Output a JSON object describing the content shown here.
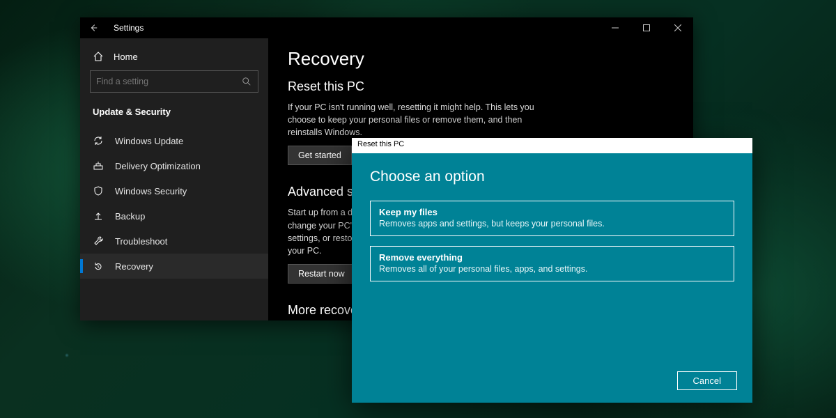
{
  "window": {
    "title": "Settings",
    "back_icon": "back-arrow-icon"
  },
  "sidebar": {
    "home_label": "Home",
    "search_placeholder": "Find a setting",
    "section_label": "Update & Security",
    "items": [
      {
        "icon": "sync-icon",
        "label": "Windows Update"
      },
      {
        "icon": "delivery-icon",
        "label": "Delivery Optimization"
      },
      {
        "icon": "shield-icon",
        "label": "Windows Security"
      },
      {
        "icon": "backup-icon",
        "label": "Backup"
      },
      {
        "icon": "wrench-icon",
        "label": "Troubleshoot"
      },
      {
        "icon": "recovery-icon",
        "label": "Recovery"
      }
    ]
  },
  "content": {
    "page_title": "Recovery",
    "reset": {
      "heading": "Reset this PC",
      "body": "If your PC isn't running well, resetting it might help. This lets you choose to keep your personal files or remove them, and then reinstalls Windows.",
      "button": "Get started"
    },
    "advanced": {
      "heading": "Advanced startup",
      "body": "Start up from a device or disc (such as a USB drive or DVD), change your PC's firmware settings, change Windows startup settings, or restore Windows from a system image. This will restart your PC.",
      "button": "Restart now"
    },
    "more_heading": "More recovery options"
  },
  "dialog": {
    "titlebar": "Reset this PC",
    "heading": "Choose an option",
    "options": [
      {
        "title": "Keep my files",
        "desc": "Removes apps and settings, but keeps your personal files."
      },
      {
        "title": "Remove everything",
        "desc": "Removes all of your personal files, apps, and settings."
      }
    ],
    "cancel": "Cancel"
  }
}
